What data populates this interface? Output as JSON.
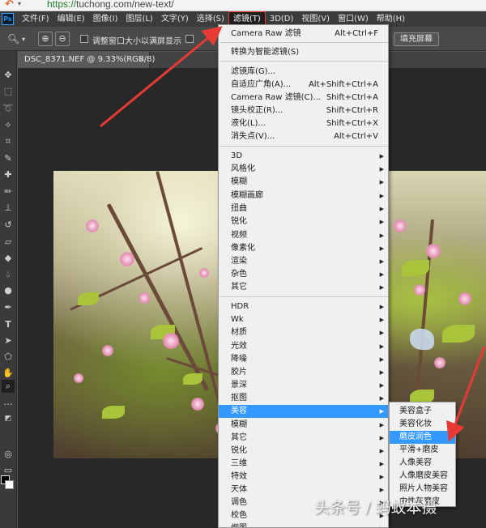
{
  "browser": {
    "url_scheme": "https://",
    "url_rest": "tuchong.com/new-text/"
  },
  "app": {
    "logo": "Ps",
    "menu": [
      "文件(F)",
      "编辑(E)",
      "图像(I)",
      "图层(L)",
      "文字(Y)",
      "选择(S)",
      "滤镜(T)",
      "3D(D)",
      "视图(V)",
      "窗口(W)",
      "帮助(H)"
    ],
    "active_menu": "滤镜(T)"
  },
  "options_bar": {
    "resize_windows_label": "调整窗口大小以满屏显示",
    "fill_screen_button": "填充屏幕"
  },
  "document": {
    "tab_title": "DSC_8371.NEF @ 9.33%(RGB/8)",
    "close_symbol": "×"
  },
  "filter_menu": {
    "items": [
      {
        "label": "Camera Raw 滤镜",
        "shortcut": "Alt+Ctrl+F"
      },
      {
        "label": "转换为智能滤镜(S)"
      },
      {
        "label": "滤镜库(G)..."
      },
      {
        "label": "自适应广角(A)...",
        "shortcut": "Alt+Shift+Ctrl+A"
      },
      {
        "label": "Camera Raw 滤镜(C)...",
        "shortcut": "Shift+Ctrl+A"
      },
      {
        "label": "镜头校正(R)...",
        "shortcut": "Shift+Ctrl+R"
      },
      {
        "label": "液化(L)...",
        "shortcut": "Shift+Ctrl+X"
      },
      {
        "label": "消失点(V)...",
        "shortcut": "Alt+Ctrl+V"
      },
      {
        "label": "3D"
      },
      {
        "label": "风格化"
      },
      {
        "label": "模糊"
      },
      {
        "label": "模糊画廊"
      },
      {
        "label": "扭曲"
      },
      {
        "label": "锐化"
      },
      {
        "label": "视频"
      },
      {
        "label": "像素化"
      },
      {
        "label": "渲染"
      },
      {
        "label": "杂色"
      },
      {
        "label": "其它"
      },
      {
        "label": "HDR"
      },
      {
        "label": "Wk"
      },
      {
        "label": "材质"
      },
      {
        "label": "光效"
      },
      {
        "label": "降噪"
      },
      {
        "label": "胶片"
      },
      {
        "label": "景深"
      },
      {
        "label": "抠图"
      },
      {
        "label": "美容"
      },
      {
        "label": "模糊"
      },
      {
        "label": "其它"
      },
      {
        "label": "锐化"
      },
      {
        "label": "三维"
      },
      {
        "label": "特效"
      },
      {
        "label": "天体"
      },
      {
        "label": "调色"
      },
      {
        "label": "校色"
      },
      {
        "label": "烟图"
      }
    ],
    "highlighted": "美容"
  },
  "beauty_submenu": {
    "items": [
      "美容盒子",
      "美容化妆",
      "磨皮润色",
      "平滑+磨皮",
      "人像美容",
      "人像磨皮美容",
      "照片人物美容",
      "中性灰磨皮"
    ],
    "highlighted": "磨皮润色"
  },
  "watermark": "头条号 / 蚂蚁本摄",
  "colors": {
    "highlight": "#3399ff",
    "arrow": "#e83a35",
    "menubar": "#3c3c3c",
    "menu_bg": "#f0f0f0"
  }
}
